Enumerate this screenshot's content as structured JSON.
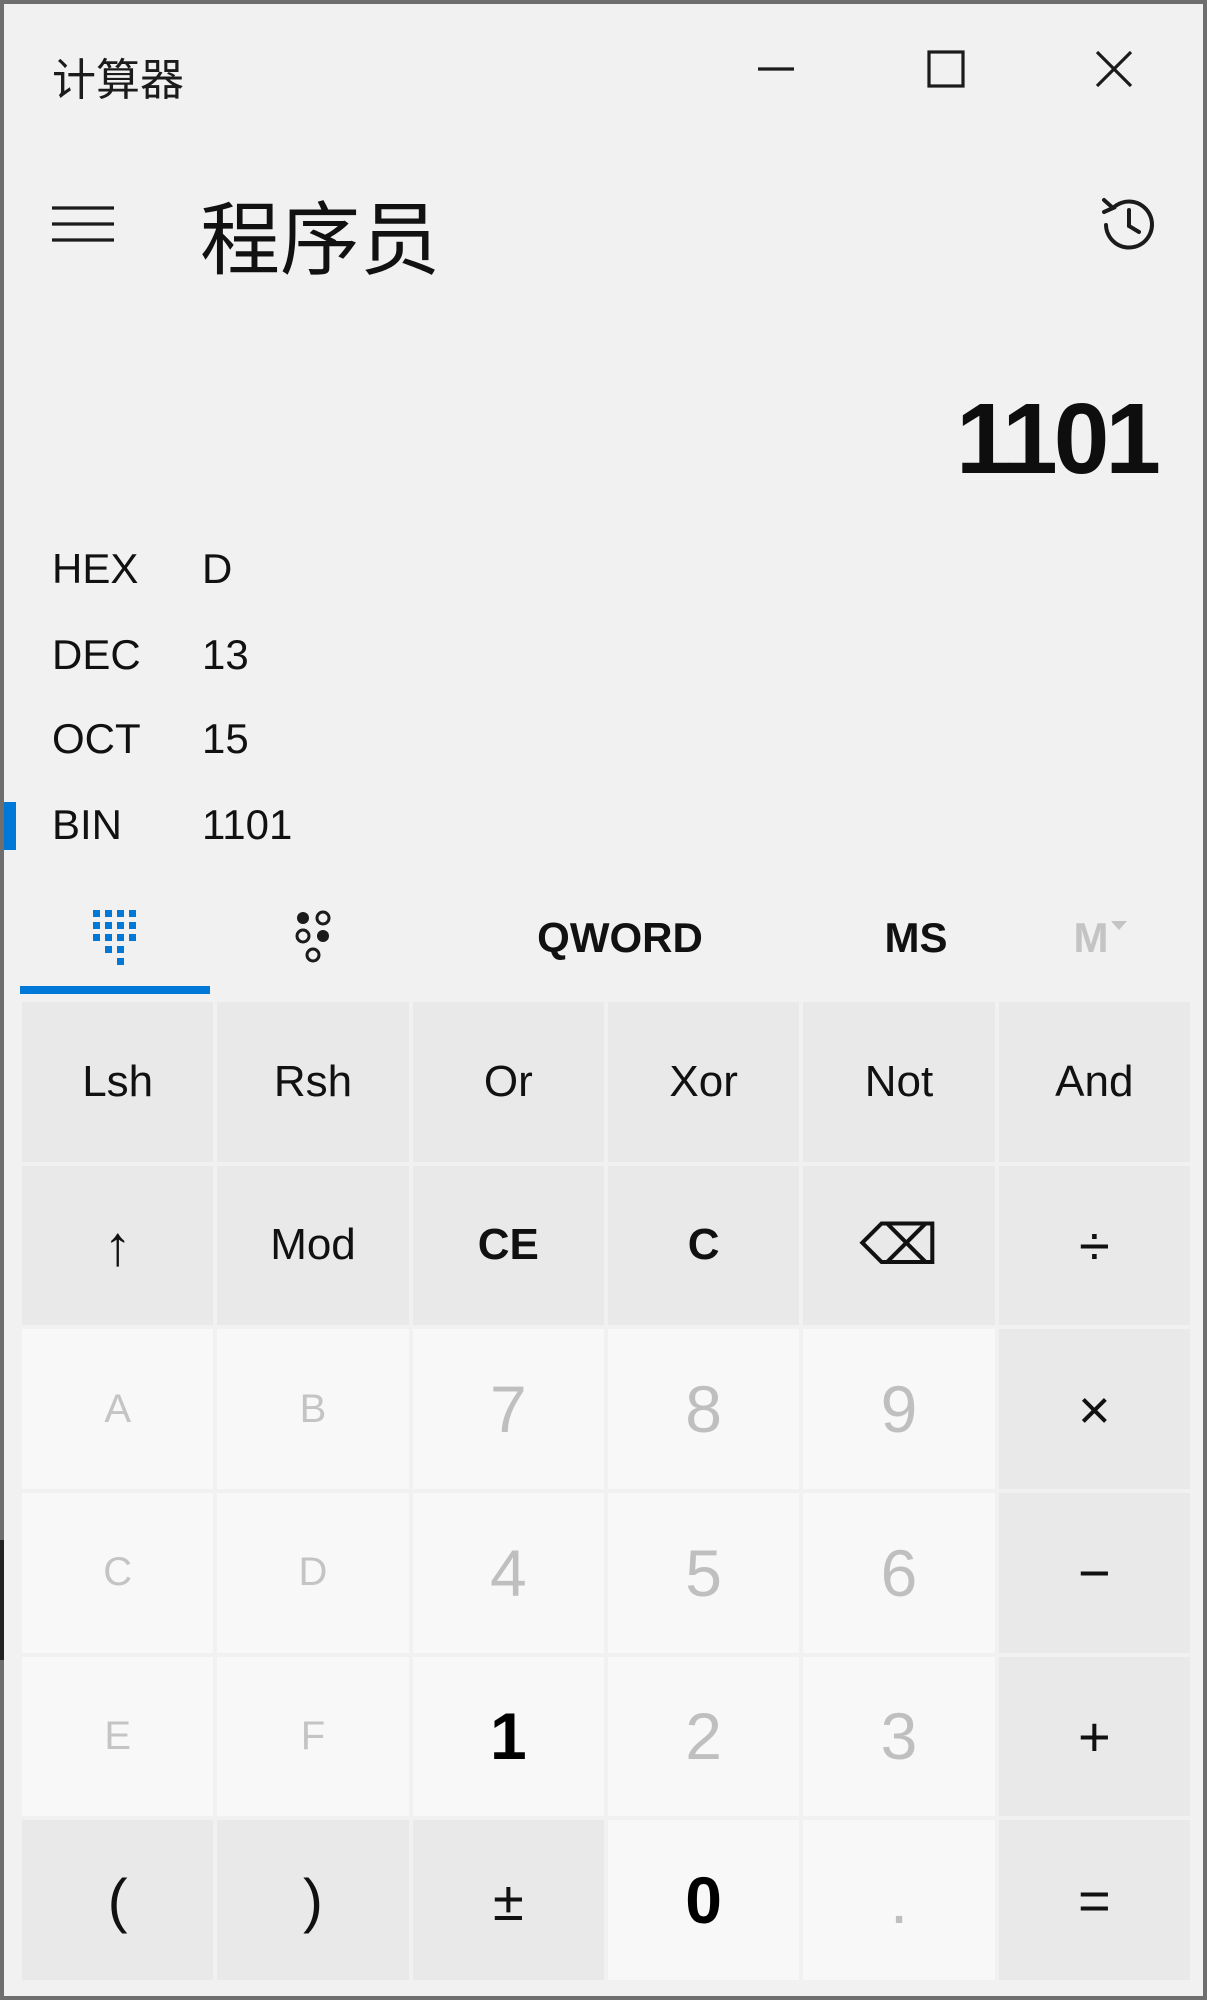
{
  "window": {
    "title": "计算器",
    "controls": {
      "minimize": "minimize",
      "maximize": "maximize",
      "close": "close"
    }
  },
  "header": {
    "mode": "程序员"
  },
  "display": {
    "value": "1101"
  },
  "radix": [
    {
      "name": "HEX",
      "value": "D",
      "selected": false
    },
    {
      "name": "DEC",
      "value": "13",
      "selected": false
    },
    {
      "name": "OCT",
      "value": "15",
      "selected": false
    },
    {
      "name": "BIN",
      "value": "1101",
      "selected": true
    }
  ],
  "toolbar": {
    "word_size": "QWORD",
    "memory_store": "MS",
    "memory_list": "M"
  },
  "keys": [
    [
      "Lsh",
      "Rsh",
      "Or",
      "Xor",
      "Not",
      "And"
    ],
    [
      "↑",
      "Mod",
      "CE",
      "C",
      "⌫",
      "÷"
    ],
    [
      "A",
      "B",
      "7",
      "8",
      "9",
      "×"
    ],
    [
      "C",
      "D",
      "4",
      "5",
      "6",
      "−"
    ],
    [
      "E",
      "F",
      "1",
      "2",
      "3",
      "+"
    ],
    [
      "(",
      ")",
      "±",
      "0",
      ".",
      "="
    ]
  ],
  "colors": {
    "accent": "#0078d7",
    "background": "#f1f1f1",
    "key_operator": "#e9e9e9",
    "key_number": "#f8f8f8",
    "disabled_text": "#bfbfbf"
  }
}
